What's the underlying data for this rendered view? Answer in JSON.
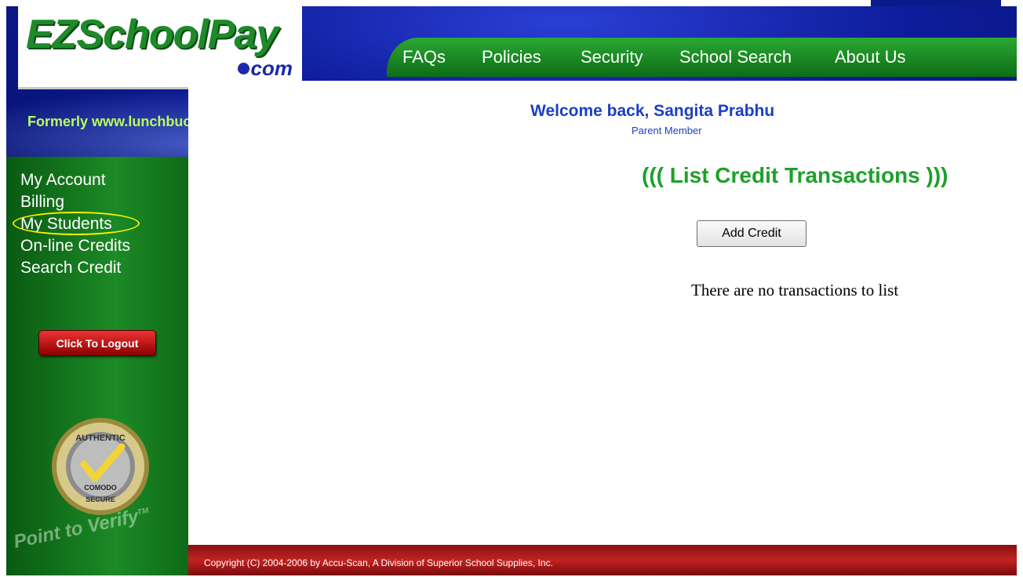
{
  "logo": {
    "main": "EZSchoolPay",
    "com": "com"
  },
  "tagline": "Formerly www.lunchbucks.com",
  "nav": [
    "FAQs",
    "Policies",
    "Security",
    "School Search",
    "About Us"
  ],
  "sidebar": {
    "items": [
      "My Account",
      "Billing",
      "My Students",
      "On-line Credits",
      "Search Credit"
    ],
    "logout_label": "Click To Logout"
  },
  "seal": {
    "top": "AUTHENTIC",
    "mid": "COMODO",
    "bottom": "SECURE",
    "verify": "Point to Verify",
    "tm": "TM"
  },
  "welcome": {
    "greeting": "Welcome back, Sangita Prabhu",
    "role": "Parent Member"
  },
  "page": {
    "title": "((( List Credit Transactions )))",
    "add_button": "Add Credit",
    "empty_message": "There are no transactions to list"
  },
  "footer": {
    "copyright": "Copyright (C) 2004-2006 by Accu-Scan, A Division of Superior School Supplies, Inc."
  },
  "colors": {
    "accent_green": "#1ea02a",
    "nav_blue": "#0b1a8a",
    "welcome_blue": "#1b3fc4",
    "footer_red": "#c22222",
    "highlight_yellow": "#f5f000"
  }
}
